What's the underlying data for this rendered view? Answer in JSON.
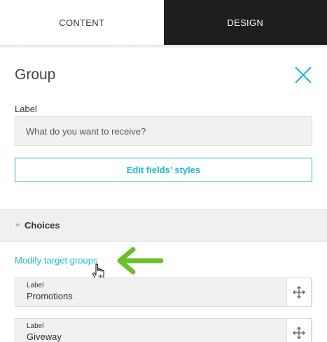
{
  "tabs": [
    {
      "label": "CONTENT",
      "active": true
    },
    {
      "label": "DESIGN",
      "active": false
    }
  ],
  "panel": {
    "title": "Group",
    "close_icon": "close-icon"
  },
  "label_field": {
    "label": "Label",
    "value": "What do you want to receive?"
  },
  "edit_styles_label": "Edit fields’ styles",
  "choices": {
    "title": "Choices",
    "modify_link": "Modify target groups",
    "items": [
      {
        "label": "Label",
        "value": "Promotions"
      },
      {
        "label": "Label",
        "value": "Giveway"
      }
    ]
  },
  "colors": {
    "accent": "#1cb7d8",
    "dark_tab": "#1e1e1e",
    "annotation_arrow": "#6cbf2b"
  }
}
